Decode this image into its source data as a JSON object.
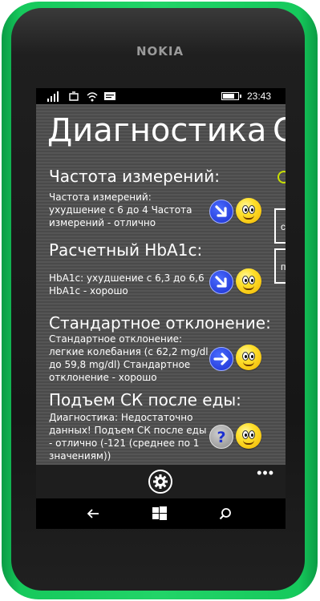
{
  "device": {
    "brand": "NOKIA"
  },
  "status_bar": {
    "time": "23:43",
    "signal_icon": "signal-bars-icon",
    "sync_icon": "data-sync-icon",
    "wifi_icon": "wifi-icon",
    "message_icon": "message-icon",
    "battery_icon": "battery-icon",
    "battery_level": 0.8
  },
  "page": {
    "title": "Диагностика",
    "next_pivot_title": "С"
  },
  "sections": [
    {
      "heading": "Частота измерений:",
      "text": "Частота измерений: ухудшение с 6 до 4 Частота измерений - отлично",
      "trend_icon": "arrow-down-right-icon",
      "mood_icon": "smiley-icon"
    },
    {
      "heading": "Расчетный HbA1c:",
      "text": "HbA1c: ухудшение с 6,3 до 6,6 HbA1c - хорошо",
      "trend_icon": "arrow-down-right-icon",
      "mood_icon": "smiley-icon"
    },
    {
      "heading": "Стандартное отклонение:",
      "text": "Стандартное отклонение: легкие колебания (с 62,2 mg/dl до 59,8 mg/dl) Стандартное отклонение - хорошо",
      "trend_icon": "arrow-right-icon",
      "mood_icon": "smiley-icon"
    },
    {
      "heading": "Подъем СК после еды:",
      "text": "Диагностика: Недостаточно данных! Подъем СК после еды - отлично (-121 (среднее по 1 значениям))",
      "trend_icon": "question-icon",
      "mood_icon": "smiley-icon"
    }
  ],
  "right_peek": {
    "items": [
      "с",
      "п"
    ]
  },
  "app_bar": {
    "more": "•••",
    "gear_icon": "gear-icon"
  },
  "nav_bar": {
    "back_icon": "back-arrow-icon",
    "start_icon": "windows-start-icon",
    "search_icon": "search-icon"
  },
  "colors": {
    "phone_body": "#22d468",
    "arrow_blue": "#1b2fd0",
    "smiley_yellow": "#ffe12e",
    "accent_lime": "#c8e000"
  }
}
